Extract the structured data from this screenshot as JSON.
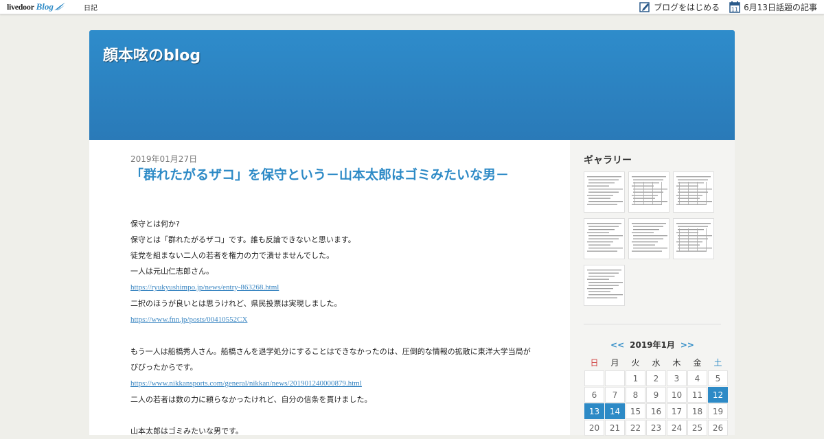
{
  "topbar": {
    "logo_main": "livedoor",
    "logo_mark": "•",
    "logo_blog": "Blog",
    "nav_diary": "日記",
    "start_blog": "ブログをはじめる",
    "calendar_icon_day": "11",
    "topic_articles": "6月13日話題の記事"
  },
  "header": {
    "blog_title": "顔本呟のblog"
  },
  "post": {
    "date": "2019年01月27日",
    "title": "「群れたがるザコ」を保守という－山本太郎はゴミみたいな男－",
    "lines": [
      "保守とは何か?",
      "保守とは「群れたがるザコ」です。誰も反論できないと思います。",
      "徒党を組まない二人の若者を権力の力で潰せませんでした。",
      "一人は元山仁志郎さん。",
      "https://ryukyushimpo.jp/news/entry-863268.html",
      "二択のほうが良いとは思うけれど、県民投票は実現しました。",
      "https://www.fnn.jp/posts/00410552CX",
      "もう一人は船橋秀人さん。船橋さんを退学処分にすることはできなかったのは、圧倒的な情報の拡散に東洋大学当局がびびったからです。",
      "https://www.nikkansports.com/general/nikkan/news/201901240000879.html",
      "二人の若者は数の力に頼らなかったけれど、自分の信条を貫けました。",
      "山本太郎はゴミみたいな男です。"
    ]
  },
  "sidebar": {
    "gallery_title": "ギャラリー",
    "thumb_labels": [
      "gallery-image-1",
      "gallery-image-2",
      "gallery-image-3",
      "gallery-image-4",
      "gallery-image-5",
      "gallery-image-6",
      "gallery-image-7"
    ],
    "calendar": {
      "prev": "<<",
      "month": "2019年1月",
      "next": ">>",
      "weekdays": [
        "日",
        "月",
        "火",
        "水",
        "木",
        "金",
        "土"
      ],
      "rows": [
        [
          "",
          "",
          "1",
          "2",
          "3",
          "4",
          "5"
        ],
        [
          "6",
          "7",
          "8",
          "9",
          "10",
          "11",
          "12"
        ],
        [
          "13",
          "14",
          "15",
          "16",
          "17",
          "18",
          "19"
        ],
        [
          "20",
          "21",
          "22",
          "23",
          "24",
          "25",
          "26"
        ]
      ],
      "linked_days": [
        "12",
        "13",
        "14"
      ]
    }
  },
  "colors": {
    "accent": "#2d8ac6",
    "header": "#2e8ccb",
    "sunday": "#d04040"
  }
}
